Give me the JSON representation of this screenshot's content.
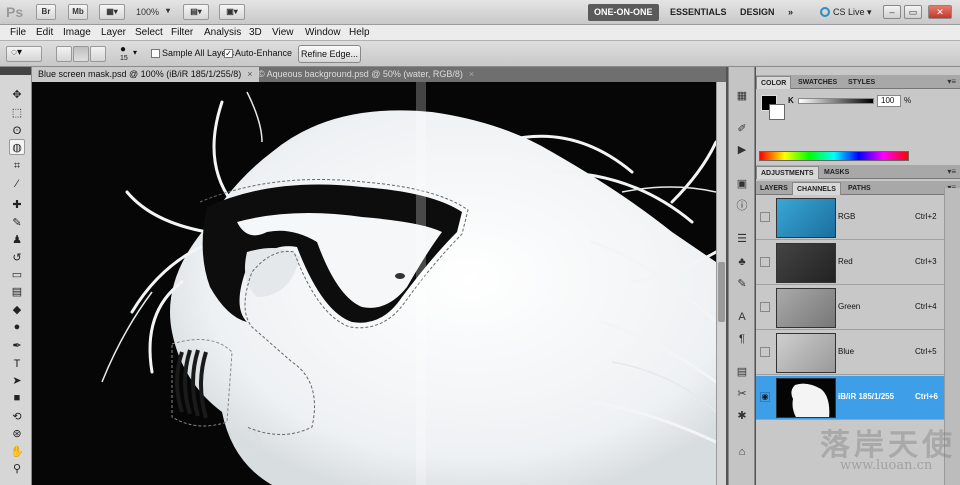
{
  "app": {
    "logo": "Ps",
    "bridge_btn": "Br",
    "minibridge_btn": "Mb",
    "zoom": "100%",
    "workspaces": [
      "ONE-ON-ONE",
      "ESSENTIALS",
      "DESIGN"
    ],
    "workspace_more": "»",
    "cs_live": "CS Live"
  },
  "menu": [
    "File",
    "Edit",
    "Image",
    "Layer",
    "Select",
    "Filter",
    "Analysis",
    "3D",
    "View",
    "Window",
    "Help"
  ],
  "options": {
    "brush_size": "15",
    "sample_all_layers": "Sample All Layers",
    "auto_enhance": "Auto-Enhance",
    "refine_edge": "Refine Edge..."
  },
  "tabs": [
    {
      "label": "Blue screen mask.psd @ 100% (iB/iR 185/1/255/8)",
      "active": true
    },
    {
      "label": "© Aqueous background.psd @ 50% (water, RGB/8)",
      "active": false
    }
  ],
  "color_panel": {
    "tabs": [
      "COLOR",
      "SWATCHES",
      "STYLES"
    ],
    "channel": "K",
    "value": "100",
    "unit": "%"
  },
  "adjust_panel": {
    "tabs": [
      "ADJUSTMENTS",
      "MASKS"
    ]
  },
  "channels_panel": {
    "tabs": [
      "LAYERS",
      "CHANNELS",
      "PATHS"
    ],
    "rows": [
      {
        "name": "RGB",
        "shortcut": "Ctrl+2"
      },
      {
        "name": "Red",
        "shortcut": "Ctrl+3"
      },
      {
        "name": "Green",
        "shortcut": "Ctrl+4"
      },
      {
        "name": "Blue",
        "shortcut": "Ctrl+5"
      },
      {
        "name": "iB/iR 185/1/255",
        "shortcut": "Ctrl+6"
      }
    ]
  },
  "watermark": {
    "cn": "落岸天使",
    "url": "www.luoan.cn"
  },
  "colors": {
    "selected_row": "#3f9ee8",
    "workspace_active": "#5a5a5a"
  }
}
